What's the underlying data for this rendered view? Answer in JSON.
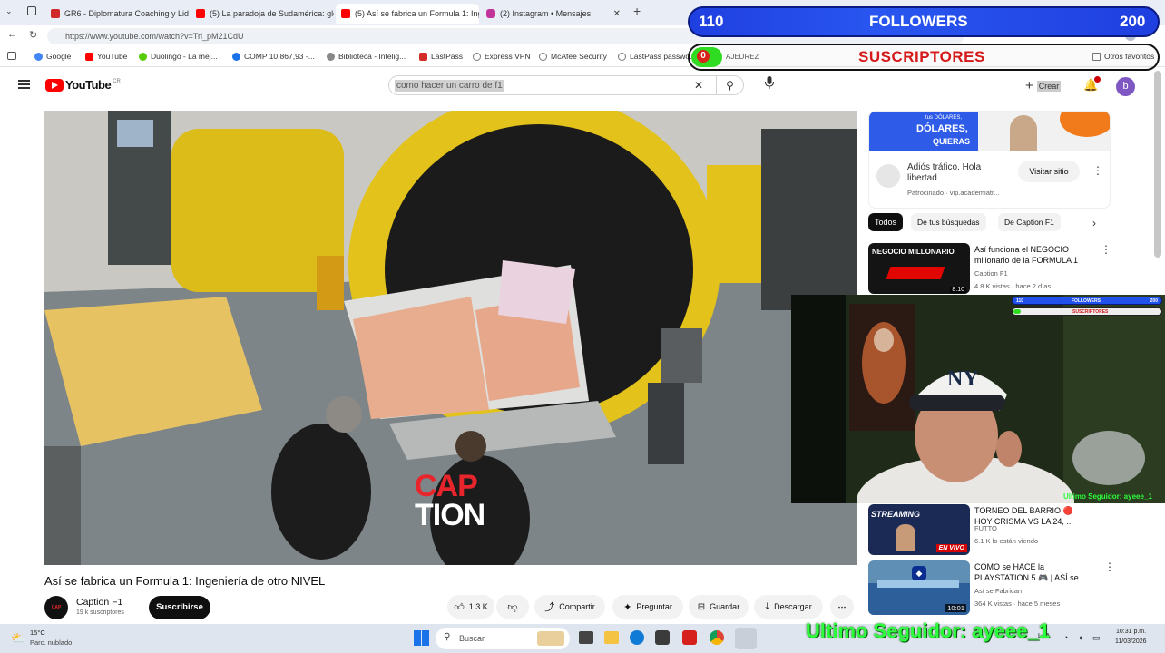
{
  "browser": {
    "tabs": [
      {
        "label": "GR6 - Diplomatura Coaching y Lid",
        "color": "#d12a2a"
      },
      {
        "label": "(5) La paradoja de Sudamérica: glo",
        "color": "#ff0000"
      },
      {
        "label": "(5) Así se fabrica un Formula 1: Ing",
        "color": "#ff0000",
        "active": true
      },
      {
        "label": "(2) Instagram • Mensajes",
        "color": "#c1359a"
      }
    ],
    "url": "https://www.youtube.com/watch?v=Tri_pM21CdU",
    "bookmarks": [
      {
        "label": "Google",
        "color": "#4285f4"
      },
      {
        "label": "YouTube",
        "color": "#ff0000"
      },
      {
        "label": "Duolingo - La mej...",
        "color": "#58cc02"
      },
      {
        "label": "COMP 10.867,93 -...",
        "color": "#1a73e8"
      },
      {
        "label": "Biblioteca - Intelig...",
        "color": "#888888"
      },
      {
        "label": "LastPass",
        "color": "#d32d27"
      },
      {
        "label": "Express VPN",
        "color": "#777777"
      },
      {
        "label": "McAfee Security",
        "color": "#777777"
      },
      {
        "label": "LastPass passwo...",
        "color": "#777777"
      }
    ],
    "other_bookmarks": "Otros favoritos"
  },
  "youtube": {
    "logo": "YouTube",
    "logo_suffix": "CR",
    "search_value": "como hacer un carro de f1",
    "create_label": "Crear",
    "avatar_letter": "b",
    "video": {
      "overlay_line1": "CAP",
      "overlay_line2": "TION",
      "title": "Así se fabrica un Formula 1: Ingeniería de otro NIVEL",
      "channel": "Caption F1",
      "subscribers": "19 k suscriptores",
      "subscribe_label": "Suscribirse",
      "likes": "1.3 K",
      "share": "Compartir",
      "ask": "Preguntar",
      "save": "Guardar",
      "download": "Descargar"
    },
    "ad": {
      "banner_text1": "tus DÓLARES,",
      "banner_text2": "DÓLARES,",
      "banner_text3": "QUIERAS",
      "title": "Adiós tráfico. Hola libertad",
      "sponsored": "Patrocinado · vip.academiatr...",
      "visit_label": "Visitar sitio"
    },
    "chips": [
      "Todos",
      "De tus búsquedas",
      "De Caption F1"
    ],
    "sidebar_videos": [
      {
        "thumb_text": "NEGOCIO MILLONARIO",
        "duration": "8:10",
        "title": "Así funciona el NEGOCIO millonario de la FORMULA 1",
        "channel": "Caption F1",
        "meta": "4.8 K vistas · hace 2 días"
      },
      {
        "thumb_text": "STREAMING",
        "duration": "EN VIVO",
        "title": "TORNEO DEL BARRIO 🔴 HOY CRISMA VS LA 24, ...",
        "channel": "FUTTO",
        "meta": "6.1 K lo están viendo"
      },
      {
        "thumb_text": "",
        "duration": "10:01",
        "title": "COMO se HACE la PLAYSTATION 5 🎮 | ASÍ se ...",
        "channel": "Así se Fabrican",
        "meta": "364 K vistas · hace 5 meses"
      }
    ]
  },
  "overlays": {
    "followers_count": "110",
    "followers_label": "FOLLOWERS",
    "followers_goal": "200",
    "subs_count": "0",
    "subs_extra": "AJEDREZ",
    "subs_label": "SUSCRIPTORES",
    "cam_followers_count": "110",
    "cam_followers_label": "FOLLOWERS",
    "cam_followers_goal": "200",
    "cam_subs_label": "SUSCRIPTORES",
    "cam_last_follower": "Ultimo Seguidor: ayeee_1",
    "last_follower": "Ultimo Seguidor: ayeee_1",
    "colors": {
      "followers_bar": "#2150ea",
      "subs_text": "#d41a1a",
      "last_follower": "#2dff3c"
    }
  },
  "taskbar": {
    "weather_temp": "15°C",
    "weather_desc": "Parc. nublado",
    "search_placeholder": "Buscar",
    "lang": "LAA",
    "time": "10:31 p.m.",
    "date": "11/03/2026"
  }
}
